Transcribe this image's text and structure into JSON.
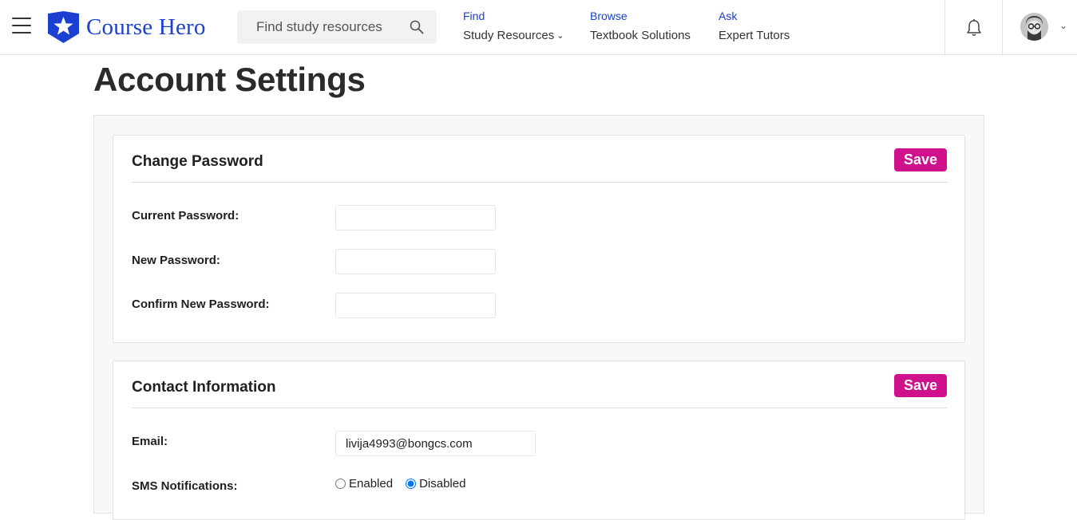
{
  "header": {
    "brand": "Course Hero",
    "search": {
      "placeholder": "Find study resources",
      "value": ""
    },
    "nav": [
      {
        "kicker": "Find",
        "label": "Study Resources",
        "has_dropdown": true
      },
      {
        "kicker": "Browse",
        "label": "Textbook Solutions",
        "has_dropdown": false
      },
      {
        "kicker": "Ask",
        "label": "Expert Tutors",
        "has_dropdown": false
      }
    ],
    "icons": [
      "menu-icon",
      "logo-star-icon",
      "search-icon",
      "bell-icon",
      "avatar",
      "chevron-down-icon"
    ]
  },
  "page": {
    "title": "Account Settings"
  },
  "change_password": {
    "title": "Change Password",
    "save_label": "Save",
    "fields": [
      {
        "label": "Current Password:",
        "value": ""
      },
      {
        "label": "New Password:",
        "value": ""
      },
      {
        "label": "Confirm New Password:",
        "value": ""
      }
    ]
  },
  "contact_info": {
    "title": "Contact Information",
    "save_label": "Save",
    "email_label": "Email:",
    "email_value": "livija4993@bongcs.com",
    "sms_label": "SMS Notifications:",
    "sms_options": [
      {
        "label": "Enabled",
        "checked": false
      },
      {
        "label": "Disabled",
        "checked": true
      }
    ]
  },
  "colors": {
    "brand_blue": "#1b3fd0",
    "save_magenta": "#d0118c",
    "title_gray": "#2b2b2b"
  }
}
